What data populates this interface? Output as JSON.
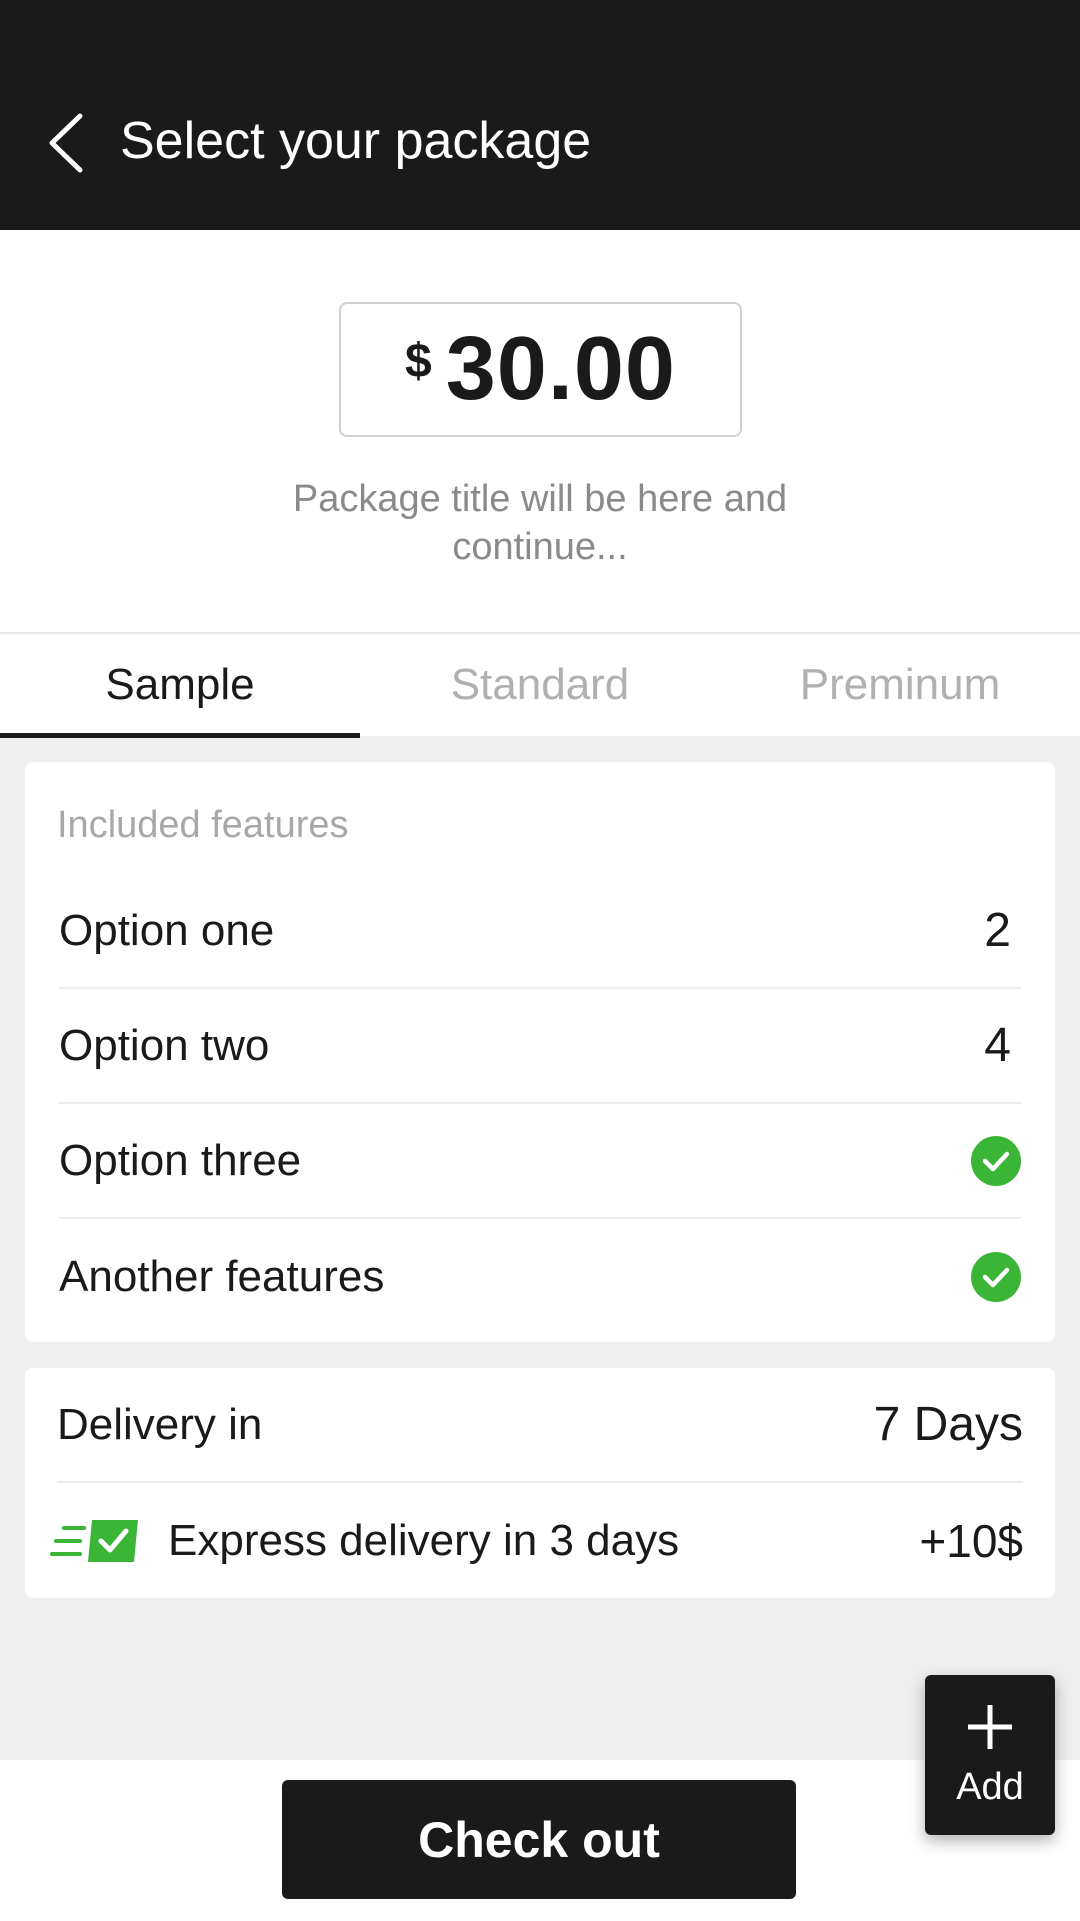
{
  "header": {
    "title": "Select your package",
    "back_icon": "chevron-left-icon"
  },
  "price": {
    "currency": "$",
    "amount": "30.00"
  },
  "package_subtitle": "Package title will be here and continue...",
  "tabs": [
    {
      "label": "Sample",
      "active": true
    },
    {
      "label": "Standard",
      "active": false
    },
    {
      "label": "Preminum",
      "active": false
    }
  ],
  "features": {
    "heading": "Included features",
    "items": [
      {
        "label": "Option one",
        "value": "2"
      },
      {
        "label": "Option two",
        "value": "4"
      },
      {
        "label": "Option three",
        "value": "check-icon"
      },
      {
        "label": "Another features",
        "value": "check-icon"
      }
    ]
  },
  "delivery": {
    "label": "Delivery in",
    "value": "7 Days",
    "express_label": "Express delivery in 3 days",
    "express_price": "+10$",
    "express_icon": "express-checkbox-icon"
  },
  "checkout_label": "Check out",
  "add_button": {
    "label": "Add",
    "icon": "plus-icon"
  },
  "colors": {
    "header_bg": "#1a1a1a",
    "accent_green": "#3bb536",
    "background": "#efefef",
    "muted_text": "#a8a8a8"
  }
}
